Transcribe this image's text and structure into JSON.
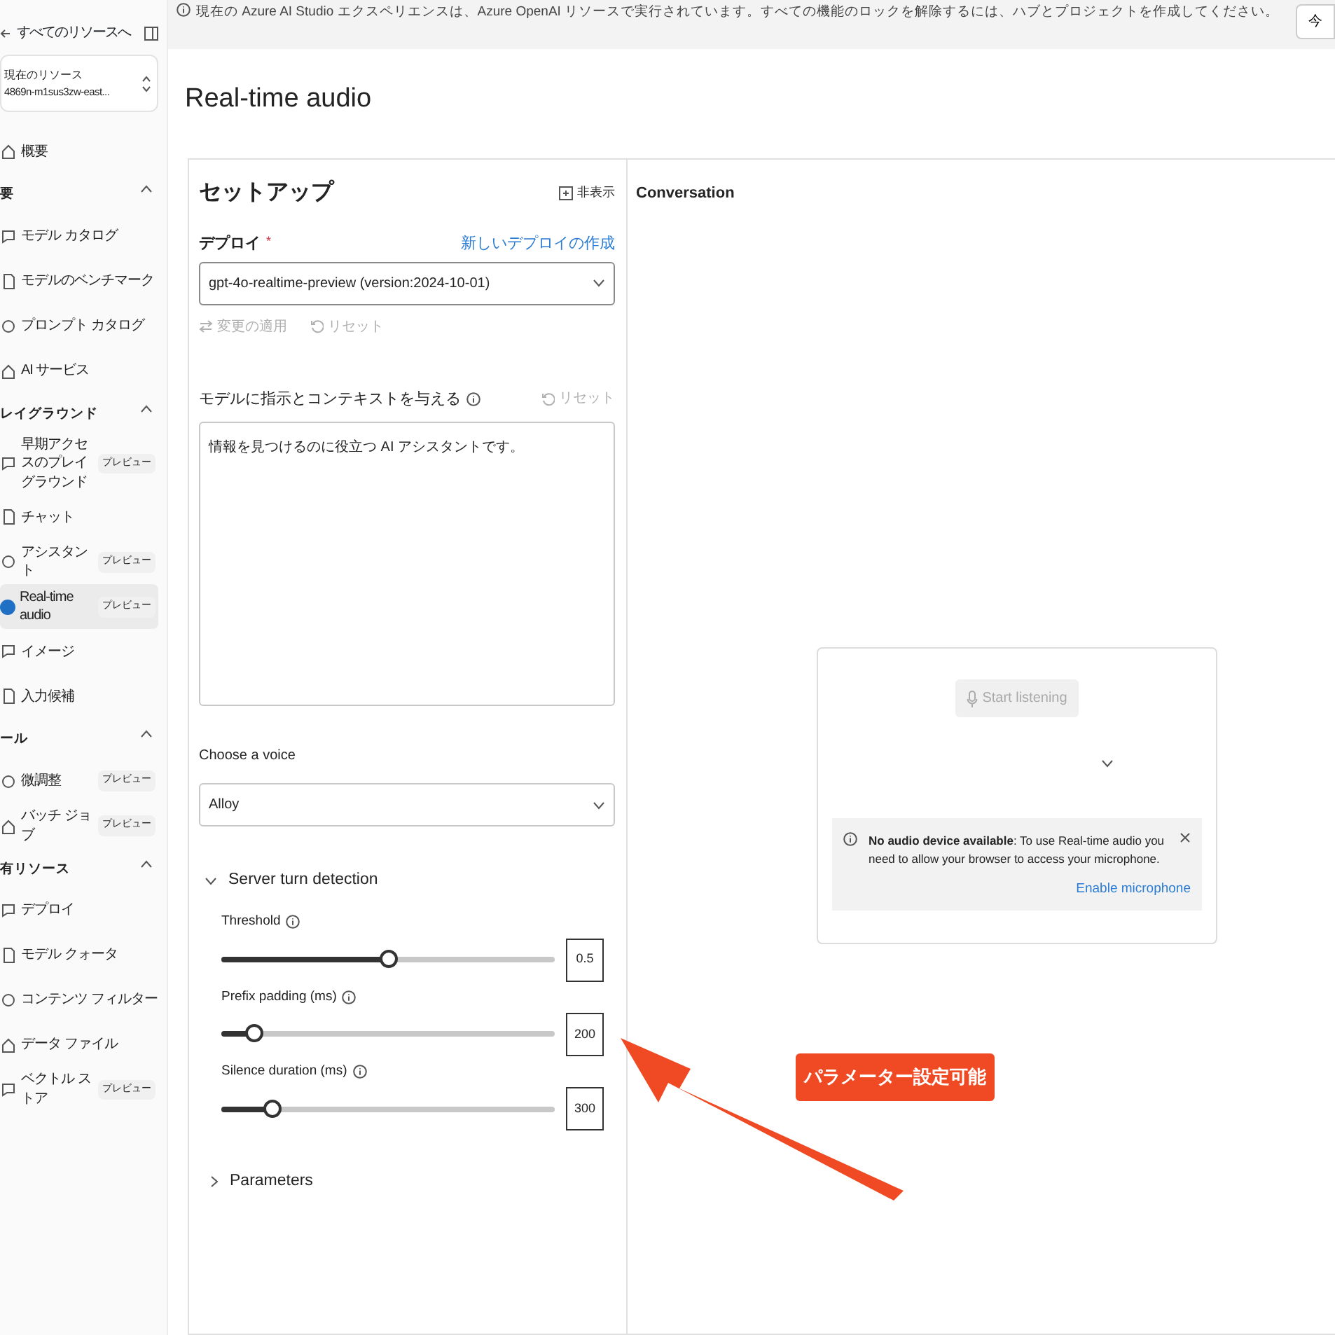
{
  "banner": {
    "text": "現在の Azure AI Studio エクスペリエンスは、Azure OpenAI リソースで実行されています。すべての機能のロックを解除するには、ハブとプロジェクトを作成してください。",
    "button": "今"
  },
  "sidebar": {
    "back_link": "すべてのリソースへ",
    "resource": {
      "label": "現在のリソース",
      "value": "4869n-m1sus3zw-east..."
    },
    "top_items": [
      {
        "label": "概要",
        "selected": false
      }
    ],
    "sections": [
      {
        "title": "要",
        "expanded": true,
        "items": [
          {
            "label": "モデル カタログ",
            "selected": false
          },
          {
            "label": "モデルのベンチマーク",
            "selected": false
          },
          {
            "label": "プロンプト カタログ",
            "selected": false
          },
          {
            "label": "AI サービス",
            "selected": false
          }
        ]
      },
      {
        "title": "レイグラウンド",
        "expanded": true,
        "items": [
          {
            "label": "早期アクセスのプレイグラウンド",
            "badge": "プレビュー",
            "selected": false
          },
          {
            "label": "チャット",
            "selected": false
          },
          {
            "label": "アシスタント",
            "badge": "プレビュー",
            "selected": false
          },
          {
            "label": "Real-time audio",
            "badge": "プレビュー",
            "selected": true
          },
          {
            "label": "イメージ",
            "selected": false
          },
          {
            "label": "入力候補",
            "selected": false
          }
        ]
      },
      {
        "title": "ール",
        "expanded": true,
        "items": [
          {
            "label": "微調整",
            "badge": "プレビュー",
            "selected": false
          },
          {
            "label": "バッチ ジョブ",
            "badge": "プレビュー",
            "selected": false
          }
        ]
      },
      {
        "title": "有リソース",
        "expanded": true,
        "items": [
          {
            "label": "デプロイ",
            "selected": false
          },
          {
            "label": "モデル クォータ",
            "selected": false
          },
          {
            "label": "コンテンツ フィルター",
            "selected": false
          },
          {
            "label": "データ ファイル",
            "selected": false
          },
          {
            "label": "ベクトル ストア",
            "badge": "プレビュー",
            "selected": false
          }
        ]
      }
    ]
  },
  "title": "Real-time audio",
  "setup": {
    "title": "セットアップ",
    "hide_button": "非表示",
    "deployment": {
      "label": "デプロイ",
      "required_mark": "*",
      "create_link": "新しいデプロイの作成",
      "value": "gpt-4o-realtime-preview (version:2024-10-01)"
    },
    "actions": [
      {
        "label": "変更の適用",
        "disabled": true
      },
      {
        "label": "リセット",
        "disabled": true
      }
    ],
    "instructions": {
      "label": "モデルに指示とコンテキストを与える",
      "reset": {
        "label": "リセット",
        "disabled": true
      },
      "value": "情報を見つけるのに役立つ AI アシスタントです。"
    },
    "voice": {
      "label": "Choose a voice",
      "value": "Alloy"
    },
    "turn_detection": {
      "title": "Server turn detection",
      "expanded": true,
      "sliders": [
        {
          "label": "Threshold",
          "level": 0.5,
          "value": "0.5"
        },
        {
          "label": "Prefix padding (ms)",
          "level": 0.095,
          "value": "200"
        },
        {
          "label": "Silence duration (ms)",
          "level": 0.15,
          "value": "300"
        }
      ]
    },
    "parameters": {
      "title": "Parameters",
      "expanded": false
    }
  },
  "conversation": {
    "title": "Conversation",
    "start_button": {
      "label": "Start listening",
      "disabled": true
    },
    "alert": {
      "text": "**No audio device available**: To use Real-time audio you need to allow your browser to access your microphone.",
      "link": "Enable microphone"
    }
  },
  "annotation": {
    "label": "パラメーター設定可能"
  }
}
